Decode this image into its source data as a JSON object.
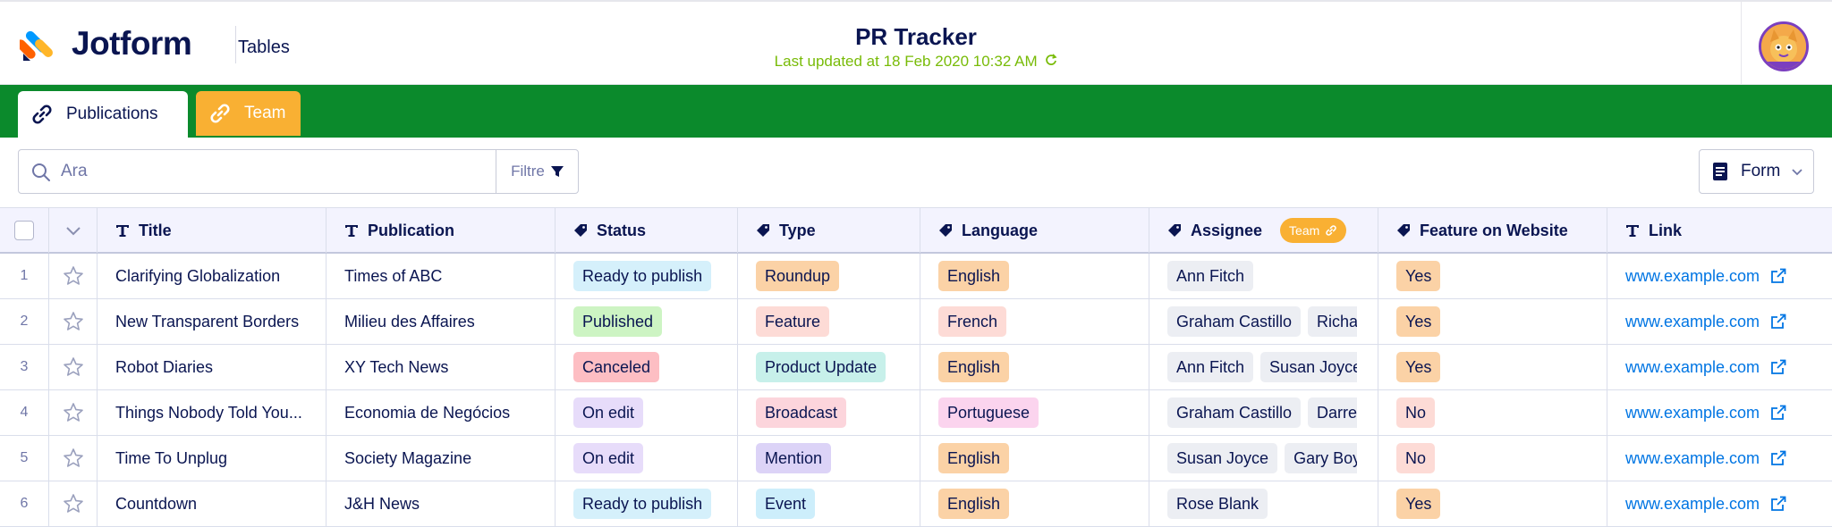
{
  "header": {
    "brand": "Jotform",
    "product": "Tables",
    "title": "PR Tracker",
    "last_updated": "Last updated at 18 Feb 2020 10:32 AM"
  },
  "tabs": [
    {
      "label": "Publications",
      "active": true
    },
    {
      "label": "Team",
      "active": false
    }
  ],
  "toolbar": {
    "search_placeholder": "Ara",
    "filter_label": "Filtre",
    "form_label": "Form"
  },
  "columns": {
    "title": "Title",
    "publication": "Publication",
    "status": "Status",
    "type": "Type",
    "language": "Language",
    "assignee": "Assignee",
    "assignee_badge": "Team",
    "feature": "Feature on Website",
    "link": "Link"
  },
  "colors": {
    "brand_green": "#0b8a2c",
    "team_orange": "#f9b033",
    "updated_green": "#78bb07",
    "link_blue": "#0075e3"
  },
  "rows": [
    {
      "num": "1",
      "title": "Clarifying Globalization",
      "publication": "Times of ABC",
      "status": "Ready to publish",
      "type": "Roundup",
      "language": "English",
      "assignee1": "Ann Fitch",
      "assignee2": "",
      "feature": "Yes",
      "link": "www.example.com"
    },
    {
      "num": "2",
      "title": "New Transparent Borders",
      "publication": "Milieu des Affaires",
      "status": "Published",
      "type": "Feature",
      "language": "French",
      "assignee1": "Graham Castillo",
      "assignee2": "Richar",
      "feature": "Yes",
      "link": "www.example.com"
    },
    {
      "num": "3",
      "title": "Robot Diaries",
      "publication": "XY Tech News",
      "status": "Canceled",
      "type": "Product Update",
      "language": "English",
      "assignee1": "Ann Fitch",
      "assignee2": "Susan Joyce",
      "feature": "Yes",
      "link": "www.example.com"
    },
    {
      "num": "4",
      "title": "Things Nobody Told You...",
      "publication": "Economia de Negócios",
      "status": "On edit",
      "type": "Broadcast",
      "language": "Portuguese",
      "assignee1": "Graham Castillo",
      "assignee2": "Darrel",
      "feature": "No",
      "link": "www.example.com"
    },
    {
      "num": "5",
      "title": "Time To Unplug",
      "publication": "Society Magazine",
      "status": "On edit",
      "type": "Mention",
      "language": "English",
      "assignee1": "Susan Joyce",
      "assignee2": "Gary Boyl",
      "feature": "No",
      "link": "www.example.com"
    },
    {
      "num": "6",
      "title": "Countdown",
      "publication": "J&H News",
      "status": "Ready to publish",
      "type": "Event",
      "language": "English",
      "assignee1": "Rose Blank",
      "assignee2": "",
      "feature": "Yes",
      "link": "www.example.com"
    }
  ]
}
